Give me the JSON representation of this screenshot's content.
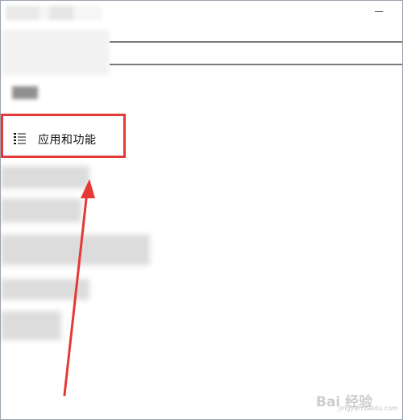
{
  "window": {
    "minimize_symbol": ""
  },
  "nav": {
    "selected_item": {
      "label": "应用和功能",
      "icon": "list-icon"
    }
  },
  "annotation": {
    "highlight_color": "#e53935",
    "arrow_color": "#e53935"
  },
  "watermark": {
    "text": "Bai 经验",
    "subtext": "jingyan.baidu.com"
  }
}
